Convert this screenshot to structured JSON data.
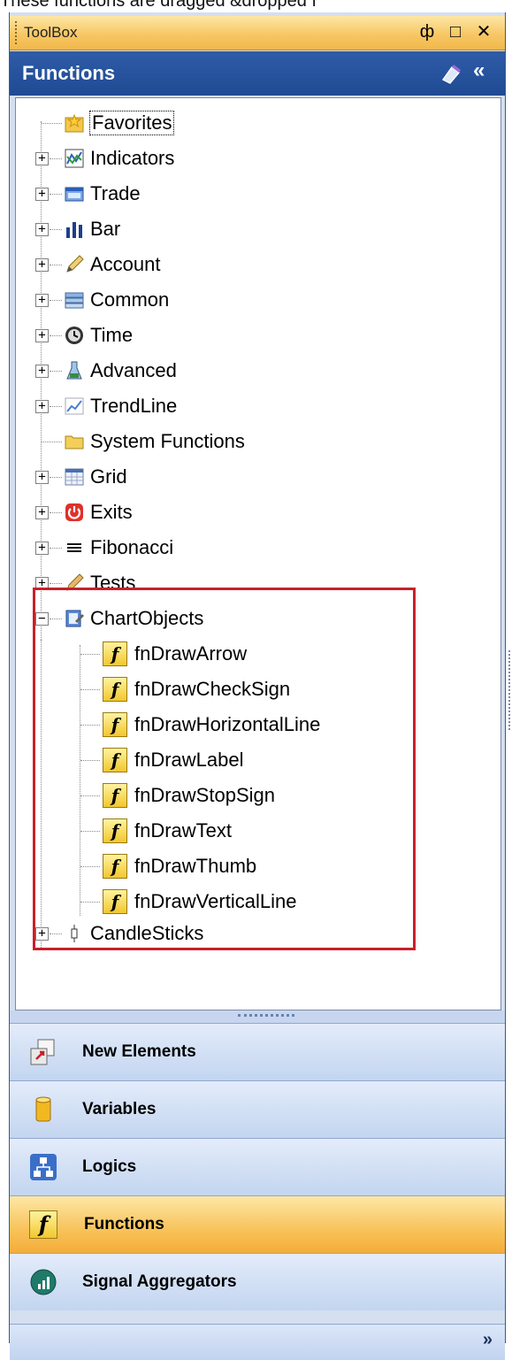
{
  "caption": "These functions are dragged &dropped f",
  "toolbox": {
    "title": "ToolBox",
    "pin_glyph": "ф",
    "maximize_glyph": "□",
    "close_glyph": "✕"
  },
  "functions_header": {
    "title": "Functions",
    "collapse_glyph": "«"
  },
  "tree": {
    "nodes": [
      {
        "label": "Favorites",
        "icon": "favorites-star-folder-icon",
        "expander": ""
      },
      {
        "label": "Indicators",
        "icon": "indicators-chart-icon",
        "expander": "+"
      },
      {
        "label": "Trade",
        "icon": "trade-window-icon",
        "expander": "+"
      },
      {
        "label": "Bar",
        "icon": "bar-chart-icon",
        "expander": "+"
      },
      {
        "label": "Account",
        "icon": "account-pencil-icon",
        "expander": "+"
      },
      {
        "label": "Common",
        "icon": "common-stack-icon",
        "expander": "+"
      },
      {
        "label": "Time",
        "icon": "time-clock-icon",
        "expander": "+"
      },
      {
        "label": "Advanced",
        "icon": "advanced-flask-icon",
        "expander": "+"
      },
      {
        "label": "TrendLine",
        "icon": "trendline-icon",
        "expander": "+"
      },
      {
        "label": "System Functions",
        "icon": "folder-icon",
        "expander": ""
      },
      {
        "label": "Grid",
        "icon": "grid-icon",
        "expander": "+"
      },
      {
        "label": "Exits",
        "icon": "exits-power-icon",
        "expander": "+"
      },
      {
        "label": "Fibonacci",
        "icon": "fibonacci-lines-icon",
        "expander": "+"
      },
      {
        "label": "Tests",
        "icon": "tests-pencil-icon",
        "expander": "+"
      },
      {
        "label": "ChartObjects",
        "icon": "chartobjects-icon",
        "expander": "−"
      }
    ],
    "chart_object_functions": [
      "fnDrawArrow",
      "fnDrawCheckSign",
      "fnDrawHorizontalLine",
      "fnDrawLabel",
      "fnDrawStopSign",
      "fnDrawText",
      "fnDrawThumb",
      "fnDrawVerticalLine"
    ],
    "function_icon_glyph": "f",
    "last_node": {
      "label": "CandleSticks",
      "icon": "candlesticks-icon",
      "expander": "+"
    }
  },
  "nav": {
    "buttons": [
      {
        "label": "New Elements",
        "icon": "new-elements-icon",
        "active": false
      },
      {
        "label": "Variables",
        "icon": "variables-cylinder-icon",
        "active": false
      },
      {
        "label": "Logics",
        "icon": "logics-hierarchy-icon",
        "active": false
      },
      {
        "label": "Functions",
        "icon": "functions-icon",
        "active": true
      },
      {
        "label": "Signal Aggregators",
        "icon": "signal-aggregators-icon",
        "active": false
      }
    ],
    "more_glyph": "»"
  },
  "colors": {
    "header_blue": "#2f5ca8",
    "title_orange": "#f7c765",
    "highlight_red": "#c8202a",
    "nav_blue": "#c3d5f0"
  }
}
